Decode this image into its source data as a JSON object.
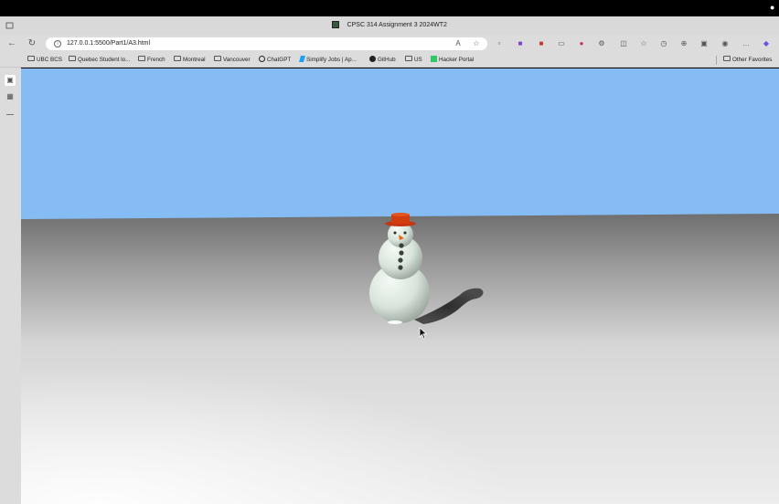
{
  "window": {
    "title": "CPSC 314 Assignment 3 2024WT2"
  },
  "address_bar": {
    "url": "127.0.0.1:5500/Part1/A3.html"
  },
  "bookmarks": [
    {
      "label": "UBC BCS",
      "icon": "folder-icon"
    },
    {
      "label": "Quebec Student lo...",
      "icon": "folder-icon"
    },
    {
      "label": "French",
      "icon": "folder-icon"
    },
    {
      "label": "Montreal",
      "icon": "folder-icon"
    },
    {
      "label": "Vancouver",
      "icon": "folder-icon"
    },
    {
      "label": "ChatGPT",
      "icon": "chatgpt-icon"
    },
    {
      "label": "Simplify Jobs | Ap...",
      "icon": "simplify-icon"
    },
    {
      "label": "GitHub",
      "icon": "github-icon"
    },
    {
      "label": "US",
      "icon": "folder-icon"
    },
    {
      "label": "Hacker Portal",
      "icon": "hacker-portal-icon"
    }
  ],
  "other_favorites": {
    "label": "Other Favorites"
  },
  "scene": {
    "sky_color": "#86bcf4",
    "ground_color": "#e9e9e9",
    "snowman_color": "#e4ede6",
    "hat_color": "#d23d10",
    "nose_color": "#e06a12",
    "button_color": "#3a3f3a"
  }
}
